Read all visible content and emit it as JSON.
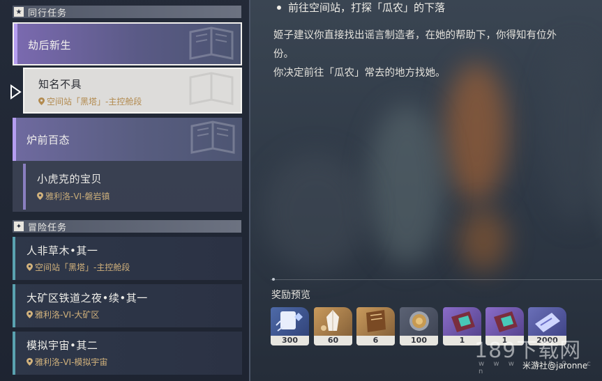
{
  "sections": {
    "companion": {
      "title": "同行任务",
      "icon": "star-badge-icon"
    },
    "adventure": {
      "title": "冒险任务",
      "icon": "diamond-star-badge-icon"
    }
  },
  "quests": {
    "group1": {
      "title": "劫后新生",
      "sub": [
        {
          "title": "知名不具",
          "location": "空间站「黑塔」-主控舱段"
        }
      ]
    },
    "group2": {
      "title": "炉前百态",
      "sub": [
        {
          "title": "小虎克的宝贝",
          "location": "雅利洛-VI-磐岩镇"
        }
      ]
    },
    "adventure": [
      {
        "title": "人非草木•其一",
        "location": "空间站「黑塔」-主控舱段"
      },
      {
        "title": "大矿区铁道之夜•续•其一",
        "location": "雅利洛-VI-大矿区"
      },
      {
        "title": "模拟宇宙•其二",
        "location": "雅利洛-VI-模拟宇宙"
      }
    ]
  },
  "detail": {
    "objective": "前往空间站，打探「瓜农」的下落",
    "description": "姬子建议你直接找出谣言制造者，在她的帮助下，你得知有位外\n份。\n你决定前往「瓜农」常去的地方找她。",
    "rewards_title": "奖励预览",
    "rewards": [
      {
        "icon": "stellar-jade-icon",
        "count": "300"
      },
      {
        "icon": "crystal-icon",
        "count": "60"
      },
      {
        "icon": "book-icon",
        "count": "6"
      },
      {
        "icon": "coin-icon",
        "count": "100"
      },
      {
        "icon": "relic-book-icon",
        "count": "1"
      },
      {
        "icon": "relic-book-icon",
        "count": "1"
      },
      {
        "icon": "ticket-icon",
        "count": "2000"
      }
    ]
  },
  "watermark": {
    "main": "189下载网",
    "sub": "w w w . 1 8 9 . c n",
    "credit": "米游社@jaronne"
  },
  "colors": {
    "accent_purple": "#9b87e0",
    "accent_teal": "#5aa2b0",
    "location_gold": "#c9ad7a"
  }
}
